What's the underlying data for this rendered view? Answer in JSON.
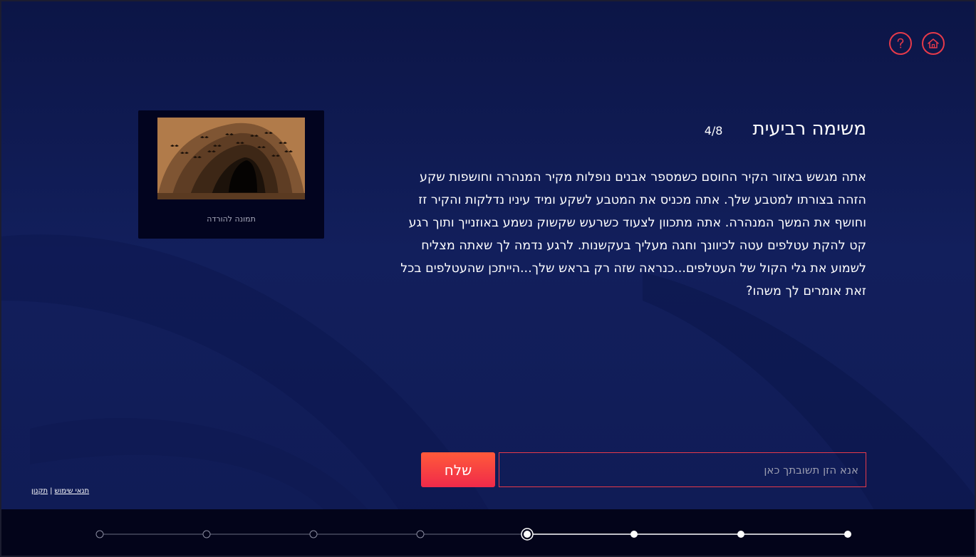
{
  "header": {
    "icons": [
      {
        "name": "help-icon",
        "glyph": "?"
      },
      {
        "name": "home-icon",
        "glyph": "home"
      }
    ]
  },
  "image_card": {
    "caption": "תמונה להורדה"
  },
  "task": {
    "title": "משימה רביעית",
    "counter": "4/8",
    "text": "אתה מגשש באזור הקיר החוסם כשמספר אבנים נופלות מקיר המנהרה וחושפות שקע הזהה בצורתו למטבע שלך. אתה מכניס את המטבע לשקע ומיד עיניו נדלקות והקיר זז וחושף את המשך המנהרה. אתה מתכוון לצעוד כשרעש שקשוק נשמע באוזנייך ותוך רגע קט להקת עטלפים עטה לכיוונך וחגה מעליך בעקשנות. לרגע נדמה לך שאתה מצליח לשמוע את גלי הקול של העטלפים...כנראה שזה רק בראש שלך...הייתכן שהעטלפים בכל זאת אומרים לך משהו?"
  },
  "answer": {
    "placeholder": "אנא הזן תשובתך כאן",
    "value": "",
    "send_label": "שלח"
  },
  "footer": {
    "terms_label": "תנאי שימוש",
    "separator": "|",
    "rules_label": "תקנון"
  },
  "progress": {
    "total": 8,
    "current": 4,
    "completed": 3
  },
  "colors": {
    "accent": "#e63a4a",
    "background": "#111d58",
    "bottom_bar": "#03041a"
  }
}
